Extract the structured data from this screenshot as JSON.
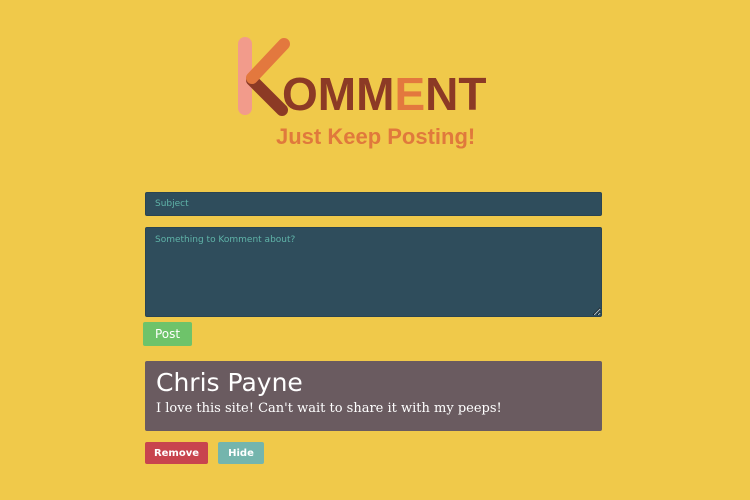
{
  "logo": {
    "first_letter": "K",
    "rest_letters": [
      "O",
      "M",
      "M",
      "E",
      "N",
      "T"
    ],
    "letter_colors": [
      "#8c3a25",
      "#8c3a25",
      "#8c3a25",
      "#e3783e",
      "#8c3a25",
      "#8c3a25"
    ],
    "k_colors": {
      "stem": "#f29b8b",
      "upper_arm": "#e3783e",
      "lower_arm": "#8c3a25"
    },
    "tagline": "Just Keep Posting!"
  },
  "form": {
    "subject_placeholder": "Subject",
    "body_placeholder": "Something to Komment about?",
    "post_label": "Post"
  },
  "comments": [
    {
      "author": "Chris Payne",
      "text": "I love this site! Can't wait to share it with my peeps!",
      "remove_label": "Remove",
      "hide_label": "Hide"
    }
  ],
  "colors": {
    "background": "#f0c94a",
    "input_bg": "#2f4d5c",
    "placeholder": "#5fb3a8",
    "post_button": "#6ec36a",
    "card_bg": "#6a5b60",
    "remove_button": "#c8444e",
    "hide_button": "#74b5ad"
  }
}
